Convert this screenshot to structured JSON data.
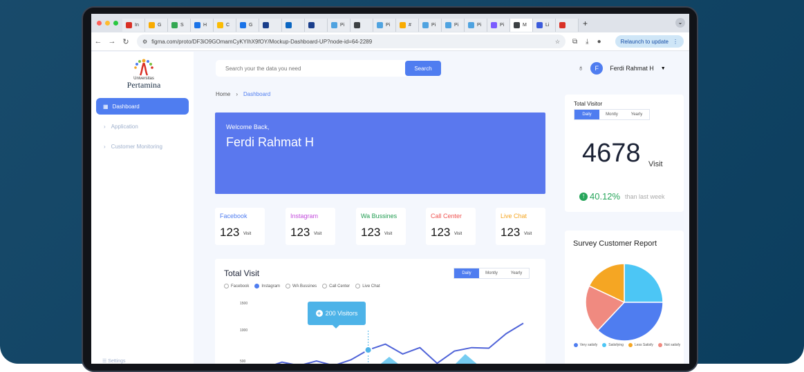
{
  "browser": {
    "tabs": [
      {
        "label": "In",
        "color": "#d93025",
        "active": false
      },
      {
        "label": "G",
        "color": "#f9ab00",
        "active": false
      },
      {
        "label": "S",
        "color": "#34a853",
        "active": false
      },
      {
        "label": "H",
        "color": "#1a73e8",
        "active": false
      },
      {
        "label": "C",
        "color": "#fbbc04",
        "active": false
      },
      {
        "label": "G",
        "color": "#1a73e8",
        "active": false
      },
      {
        "label": "",
        "color": "#1a3e8b",
        "active": false
      },
      {
        "label": "",
        "color": "#0a66c2",
        "active": false
      },
      {
        "label": "",
        "color": "#1a3e8b",
        "active": false
      },
      {
        "label": "Pi",
        "color": "#4fa3e0",
        "active": false
      },
      {
        "label": "",
        "color": "#3c4043",
        "active": false
      },
      {
        "label": "Pi",
        "color": "#4fa3e0",
        "active": false
      },
      {
        "label": "#",
        "color": "#f9ab00",
        "active": false
      },
      {
        "label": "Pi",
        "color": "#4fa3e0",
        "active": false
      },
      {
        "label": "Pi",
        "color": "#4fa3e0",
        "active": false
      },
      {
        "label": "Pi",
        "color": "#4fa3e0",
        "active": false
      },
      {
        "label": "Pi",
        "color": "#7b5cff",
        "active": false
      },
      {
        "label": "M",
        "color": "#3c4043",
        "active": true
      },
      {
        "label": "Li",
        "color": "#3b5bdb",
        "active": false
      },
      {
        "label": "",
        "color": "#d93025",
        "active": false
      }
    ],
    "url": "figma.com/proto/DF3iO9GOmamCyKYIhX9fOY/Mockup-Dashboard-UP?node-id=64-2289",
    "relaunch_label": "Relaunch to update"
  },
  "sidebar": {
    "logo_small": "Universitas",
    "logo_name": "Pertamina",
    "items": [
      {
        "label": "Dashboard"
      },
      {
        "label": "Application"
      },
      {
        "label": "Customer Monitoring"
      }
    ],
    "settings_label": "Settings"
  },
  "search": {
    "placeholder": "Search your the data you need",
    "button_label": "Search"
  },
  "user": {
    "initial": "F",
    "name": "Ferdi Rahmat H"
  },
  "breadcrumb": {
    "home": "Home",
    "current": "Dashboard"
  },
  "welcome": {
    "subtitle": "Welcome Back,",
    "name": "Ferdi Rahmat H"
  },
  "channels": [
    {
      "label": "Facebook",
      "value": "123",
      "unit": "Visit",
      "color": "#4f7df0"
    },
    {
      "label": "Instagram",
      "value": "123",
      "unit": "Visit",
      "color": "#c24bdc"
    },
    {
      "label": "Wa Bussines",
      "value": "123",
      "unit": "Visit",
      "color": "#1e9b4f"
    },
    {
      "label": "Call Center",
      "value": "123",
      "unit": "Visit",
      "color": "#ef5350"
    },
    {
      "label": "Live Chat",
      "value": "123",
      "unit": "Visit",
      "color": "#f5a623"
    }
  ],
  "total_visit": {
    "title": "Total Visit",
    "periods": [
      "Daily",
      "Montly",
      "Yearly"
    ],
    "active_period": "Daily",
    "filters": [
      "Facebook",
      "Instagram",
      "WA Bussines",
      "Call Center",
      "Live Chat"
    ],
    "active_filter": "Instagram",
    "y_ticks": [
      "1500",
      "1000",
      "500"
    ],
    "tooltip": "200 Visitors",
    "line_color": "#4f63d8",
    "area_color": "#5ec3ef"
  },
  "total_visitor": {
    "title": "Total Visitor",
    "periods": [
      "Daily",
      "Montly",
      "Yearly"
    ],
    "active_period": "Daily",
    "value": "4678",
    "unit": "Visit",
    "change": "40.12%",
    "comparison": "than last week"
  },
  "survey": {
    "title": "Survey Customer Report",
    "legend": [
      {
        "label": "Very satisfy",
        "color": "#4f7df0"
      },
      {
        "label": "Satisfying",
        "color": "#4cc6f5"
      },
      {
        "label": "Less Satisfy",
        "color": "#f5a623"
      },
      {
        "label": "Not satisfy",
        "color": "#f08a80"
      }
    ]
  },
  "chart_data": [
    {
      "type": "line",
      "title": "Total Visit",
      "yticks": [
        500,
        1000,
        1500
      ],
      "series": [
        {
          "name": "Instagram",
          "values": [
            380,
            480,
            420,
            500,
            420,
            520,
            690,
            790,
            620,
            730,
            460,
            670,
            730,
            720,
            970,
            1150
          ]
        }
      ]
    },
    {
      "type": "pie",
      "title": "Survey Customer Report",
      "categories": [
        "Satisfying",
        "Very satisfy",
        "Not satisfy",
        "Less Satisfy"
      ],
      "values": [
        25,
        37,
        20,
        18
      ]
    }
  ]
}
